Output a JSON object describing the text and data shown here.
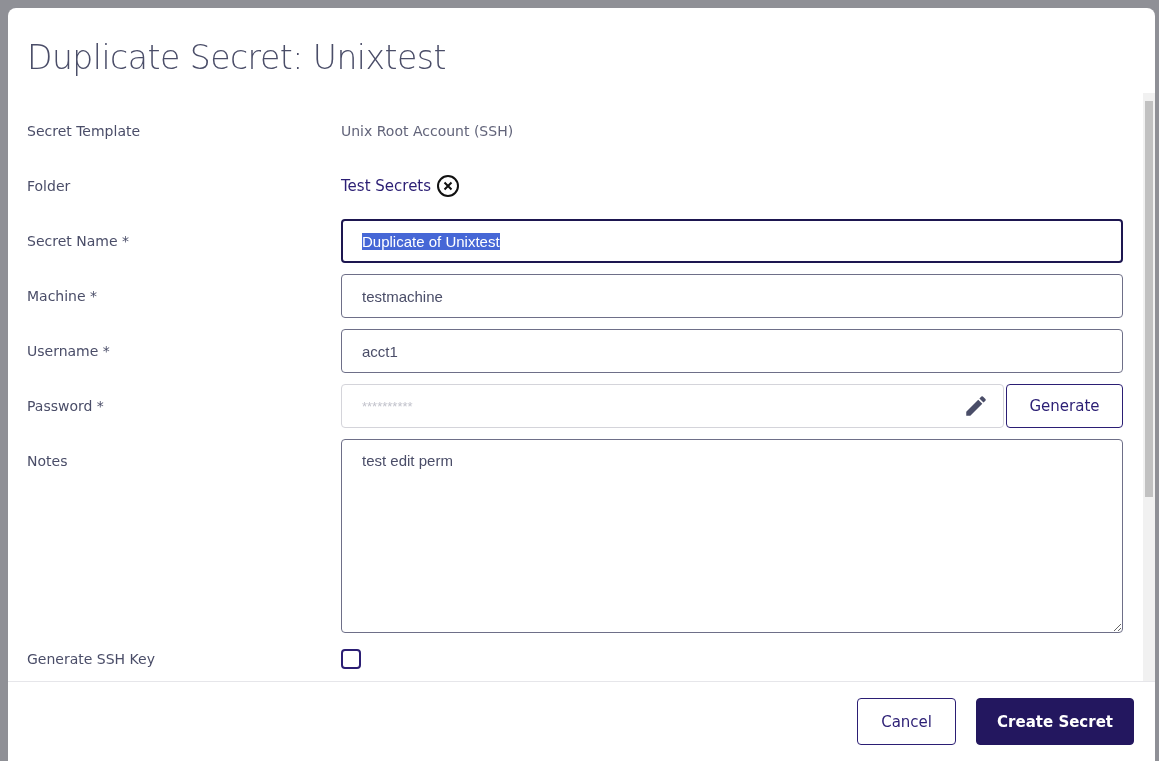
{
  "dialog": {
    "title": "Duplicate Secret: Unixtest"
  },
  "fields": [
    {
      "kind": "static",
      "label": "Secret Template",
      "value": "Unix Root Account (SSH)"
    },
    {
      "kind": "chip",
      "label": "Folder",
      "value": "Test Secrets"
    },
    {
      "kind": "input",
      "label": "Secret Name *",
      "value": "Duplicate of Unixtest",
      "focused": true,
      "highlighted": true
    },
    {
      "kind": "input",
      "label": "Machine *",
      "value": "testmachine",
      "focused": false,
      "highlighted": false
    },
    {
      "kind": "input",
      "label": "Username *",
      "value": "acct1",
      "focused": false,
      "highlighted": false
    },
    {
      "kind": "password",
      "label": "Password *",
      "placeholder": "**********",
      "button": "Generate"
    },
    {
      "kind": "textarea",
      "label": "Notes",
      "value": "test edit perm"
    },
    {
      "kind": "checkbox",
      "label": "Generate SSH Key",
      "checked": false
    }
  ],
  "buttons": [
    {
      "label": "Cancel",
      "primary": false
    },
    {
      "label": "Create Secret",
      "primary": true
    }
  ]
}
